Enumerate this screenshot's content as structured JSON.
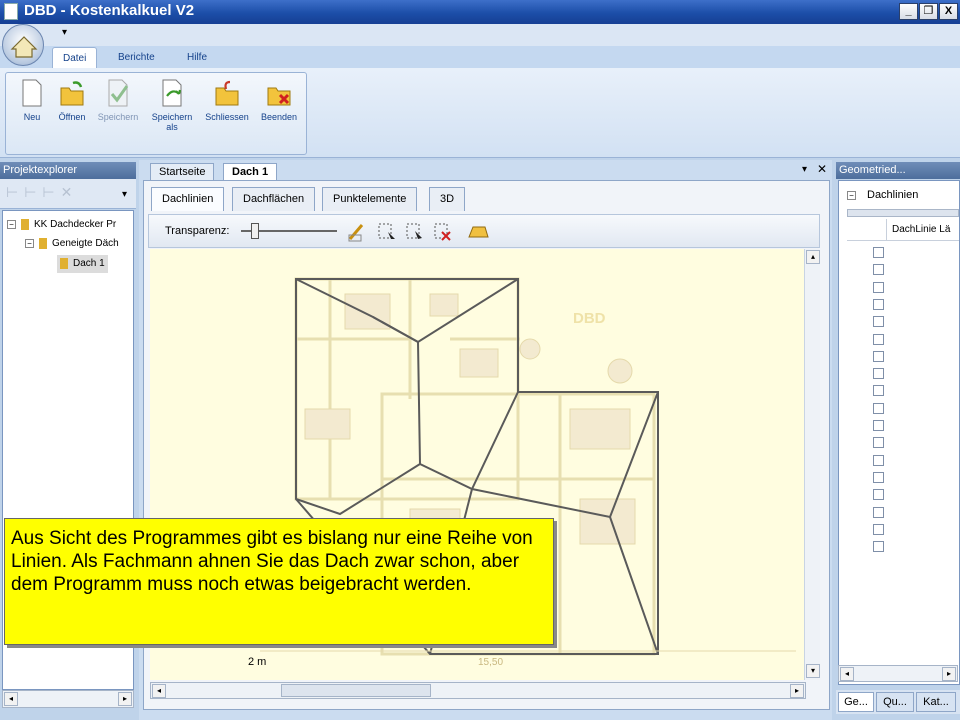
{
  "window": {
    "title": "DBD - Kostenkalkuel V2",
    "buttons": [
      "_",
      "❐",
      "X"
    ]
  },
  "ribbon": {
    "tabs": [
      "Datei",
      "Berichte",
      "Hilfe"
    ],
    "active_tab": "Datei",
    "buttons": [
      {
        "label": "Neu",
        "icon": "new-document-icon"
      },
      {
        "label": "Öffnen",
        "icon": "open-folder-icon"
      },
      {
        "label": "Speichern",
        "icon": "save-checkmark-icon"
      },
      {
        "label": "Speichern als",
        "icon": "save-as-icon"
      },
      {
        "label": "Schliessen",
        "icon": "close-folder-icon"
      },
      {
        "label": "Beenden",
        "icon": "exit-icon"
      }
    ]
  },
  "explorer": {
    "title": "Projektexplorer",
    "tree": [
      {
        "label": "KK Dachdecker Pr",
        "level": 0,
        "expander": "−"
      },
      {
        "label": "Geneigte Däch",
        "level": 1,
        "expander": "−"
      },
      {
        "label": "Dach 1",
        "level": 2,
        "expander": ""
      }
    ]
  },
  "document": {
    "tabs": [
      "Startseite",
      "Dach 1"
    ],
    "active_tab": "Dach 1",
    "inner_tabs": [
      "Dachlinien",
      "Dachflächen",
      "Punktelemente",
      "3D"
    ],
    "active_inner_tab": "Dachlinien",
    "transparency_label": "Transparenz:",
    "transparency_level": 0.15,
    "scale_label": "2 m",
    "dimension_label": "15,50",
    "logo_text": "DBD"
  },
  "geometry": {
    "title": "Geometried...",
    "node_label": "Dachlinien",
    "column_header": "DachLinie Lä",
    "row_count": 18,
    "bottom_tabs": [
      "Ge...",
      "Qu...",
      "Kat..."
    ]
  },
  "callout": {
    "text": "Aus Sicht des Programmes gibt es bislang nur eine Reihe von Linien. Als Fachmann ahnen Sie das Dach zwar schon, aber dem Programm muss noch etwas beigebracht werden."
  },
  "colors": {
    "callout_bg": "#ffff00",
    "titlebar": "#1c4ea8",
    "plan_bg": "#fffde0",
    "roof_lines": "#555555"
  }
}
